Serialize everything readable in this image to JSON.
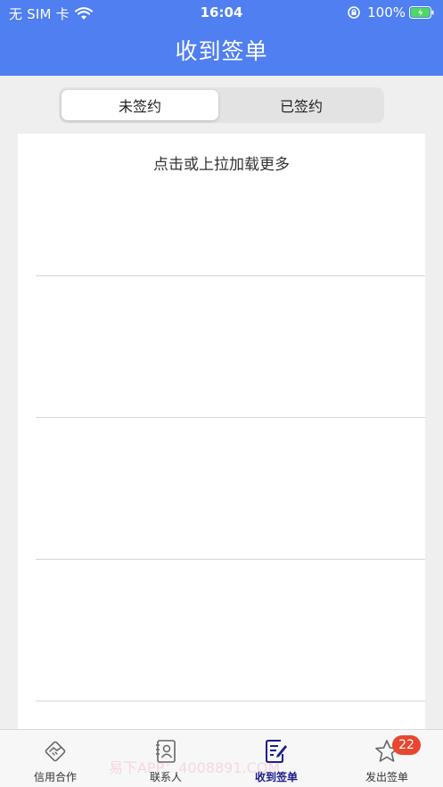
{
  "status_bar": {
    "carrier": "无 SIM 卡",
    "time": "16:04",
    "battery": "100%"
  },
  "nav": {
    "title": "收到签单"
  },
  "segments": [
    {
      "label": "未签约",
      "selected": true
    },
    {
      "label": "已签约",
      "selected": false
    }
  ],
  "list": {
    "load_more": "点击或上拉加载更多"
  },
  "tabbar": {
    "tabs": [
      {
        "label": "信用合作",
        "icon": "handshake-icon"
      },
      {
        "label": "联系人",
        "icon": "contacts-icon"
      },
      {
        "label": "收到签单",
        "icon": "edit-document-icon",
        "active": true
      },
      {
        "label": "发出签单",
        "icon": "star-icon",
        "badge": "22"
      }
    ]
  },
  "colors": {
    "header": "#4f7ff0",
    "active_tab": "#1b1b8c",
    "badge": "#e8462f"
  },
  "watermark": "易下APP：4008891.COM"
}
